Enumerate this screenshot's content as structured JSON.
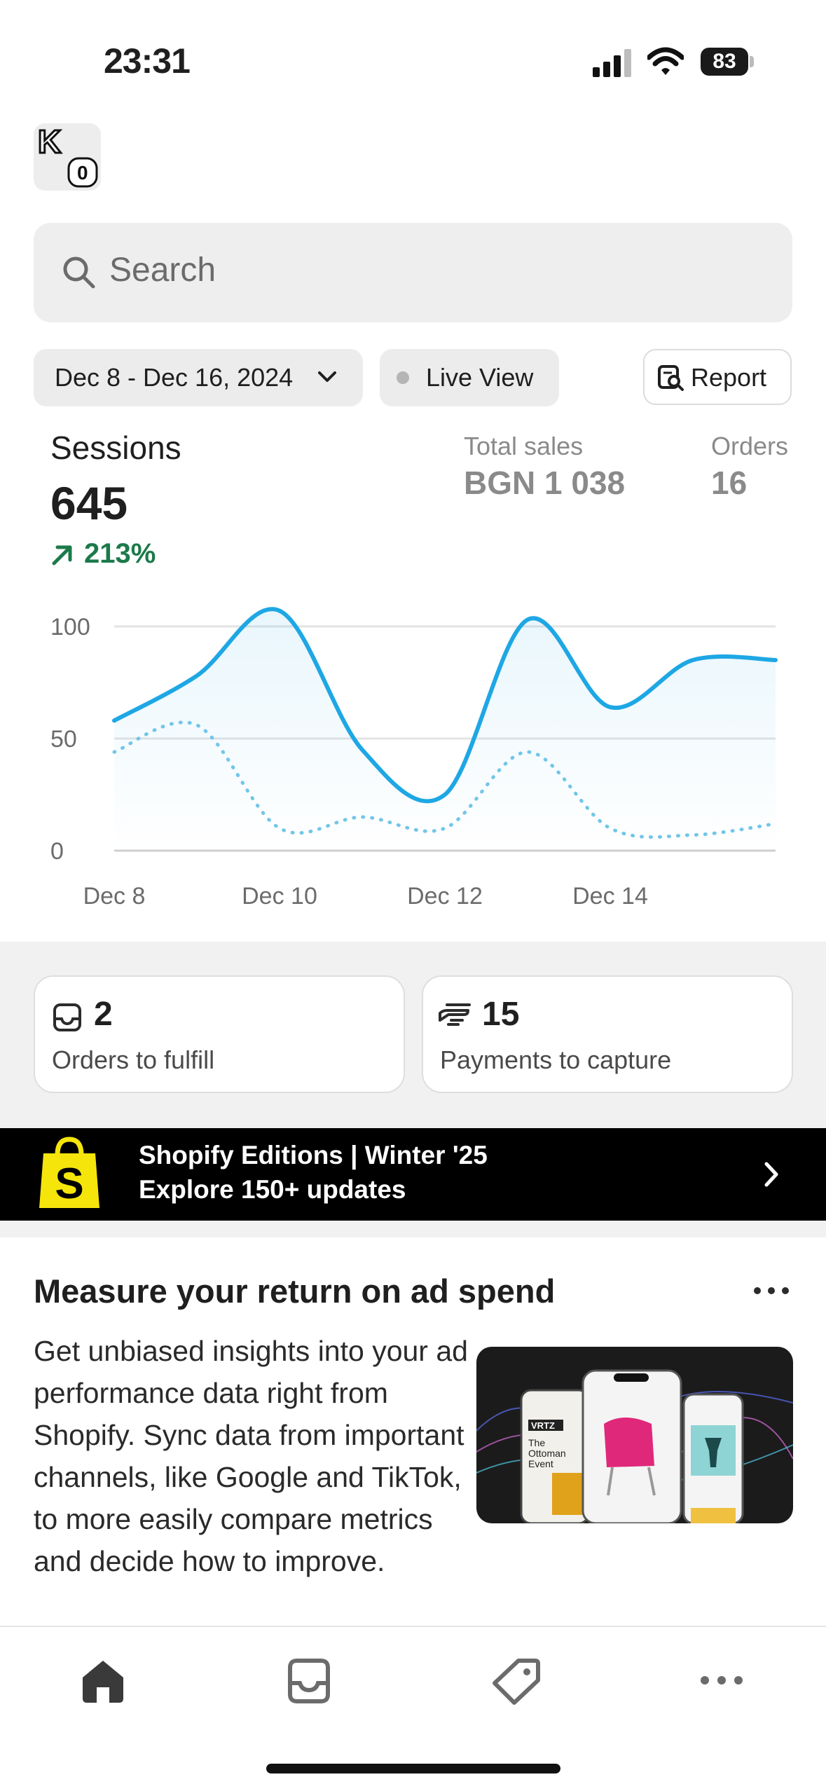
{
  "status_bar": {
    "time": "23:31",
    "battery": "83"
  },
  "avatar": {
    "letters": "K",
    "badge": "0"
  },
  "search": {
    "placeholder": "Search"
  },
  "filters": {
    "date_range": "Dec 8 - Dec 16, 2024",
    "live_view": "Live View",
    "report": "Report"
  },
  "metrics": {
    "sessions_label": "Sessions",
    "sessions_value": "645",
    "sessions_change": "213%",
    "total_sales_label": "Total sales",
    "total_sales_value": "BGN 1 038",
    "orders_label": "Orders",
    "orders_value": "16"
  },
  "chart_data": {
    "type": "line",
    "x": [
      "Dec 8",
      "Dec 9",
      "Dec 10",
      "Dec 11",
      "Dec 12",
      "Dec 13",
      "Dec 14",
      "Dec 15",
      "Dec 16"
    ],
    "x_tick_labels": [
      "Dec 8",
      "Dec 10",
      "Dec 12",
      "Dec 14"
    ],
    "ylim": [
      0,
      100
    ],
    "y_ticks": [
      0,
      50,
      100
    ],
    "grid": true,
    "series": [
      {
        "style": "solid",
        "color": "#1ea7e4",
        "values": [
          58,
          78,
          107,
          45,
          25,
          103,
          64,
          85,
          85
        ]
      },
      {
        "style": "dotted",
        "color": "#72c6e8",
        "values": [
          44,
          56,
          10,
          15,
          10,
          44,
          10,
          7,
          12
        ]
      }
    ]
  },
  "tasks": [
    {
      "count": "2",
      "label": "Orders to fulfill",
      "icon": "inbox-icon"
    },
    {
      "count": "15",
      "label": "Payments to capture",
      "icon": "payment-hand-icon"
    }
  ],
  "banner": {
    "title": "Shopify Editions | Winter '25",
    "subtitle": "Explore 150+ updates",
    "logo_letter": "S"
  },
  "article": {
    "title": "Measure your return on ad spend",
    "body": "Get unbiased insights into your ad performance data right from Shopify. Sync data from important channels, like Google and TikTok, to more easily compare metrics and decide how to improve.",
    "image_text": [
      "VRTZ",
      "The",
      "Ottoman",
      "Event"
    ]
  },
  "tabbar": {
    "items": [
      "home-icon",
      "orders-inbox-icon",
      "products-tag-icon",
      "more-icon"
    ]
  },
  "colors": {
    "accent": "#1ea7e4",
    "positive": "#1c7a4a",
    "banner_bg": "#000000",
    "shopify_yellow": "#f5e50b"
  }
}
